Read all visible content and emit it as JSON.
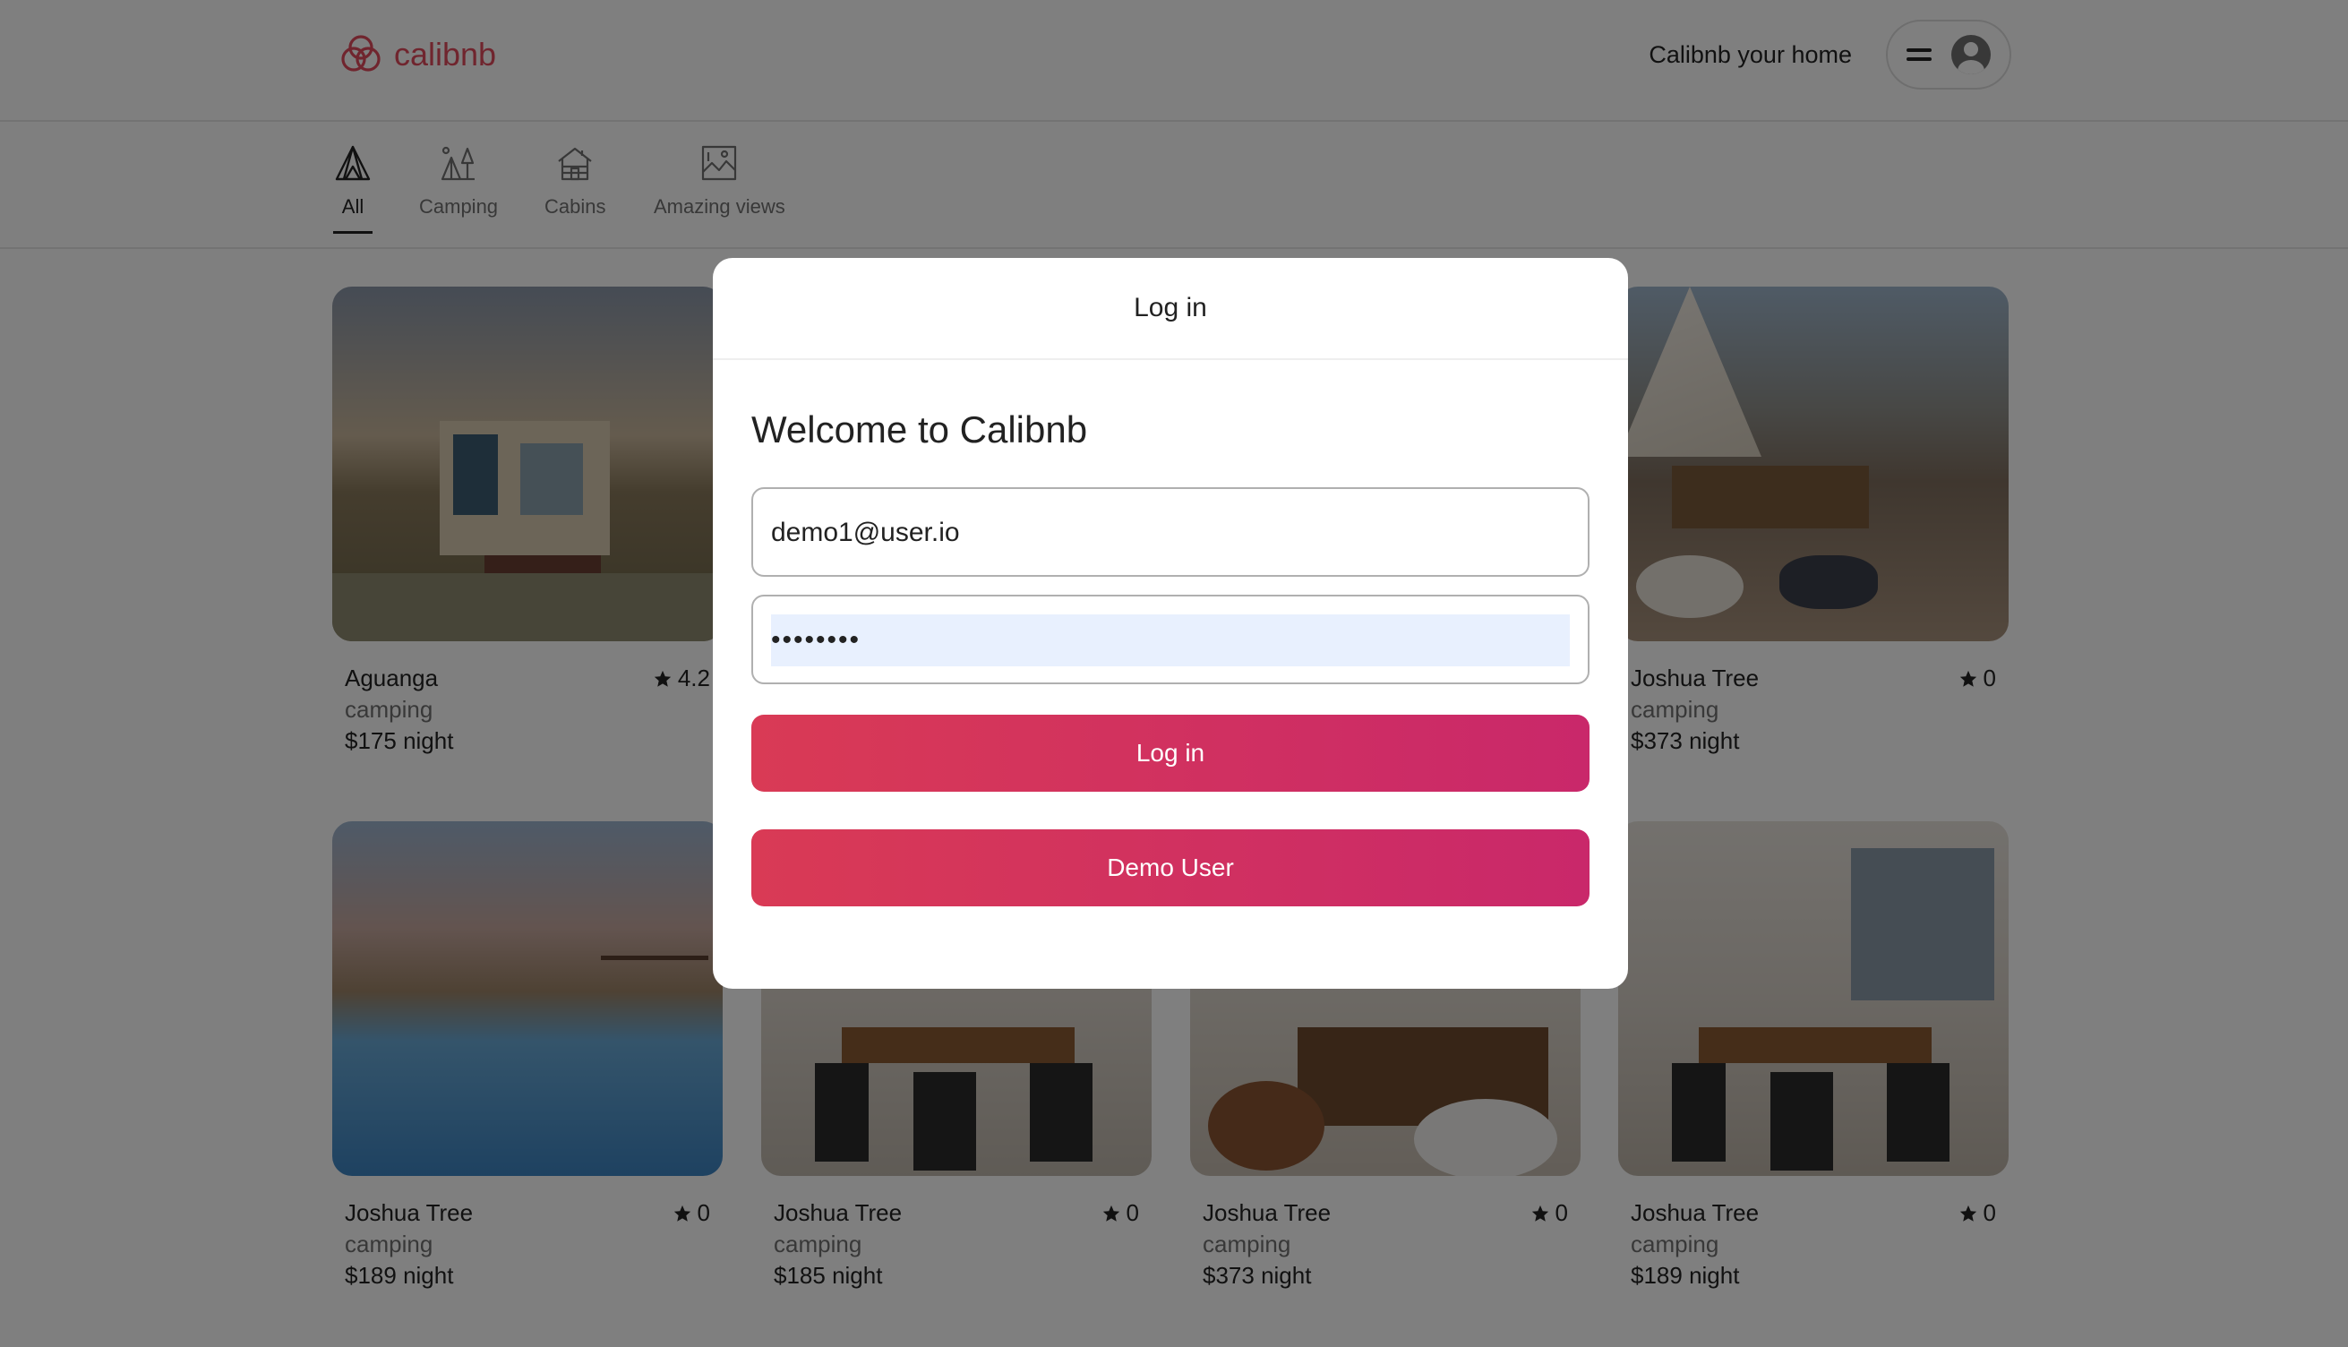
{
  "brand": {
    "name": "calibnb",
    "color": "#e14a5d"
  },
  "header": {
    "host_link": "Calibnb your home"
  },
  "categories": [
    {
      "label": "All",
      "icon": "tent-icon",
      "active": true
    },
    {
      "label": "Camping",
      "icon": "camping-icon",
      "active": false
    },
    {
      "label": "Cabins",
      "icon": "cabin-icon",
      "active": false
    },
    {
      "label": "Amazing views",
      "icon": "views-icon",
      "active": false
    }
  ],
  "listings": [
    {
      "title": "Aguanga",
      "type": "camping",
      "price": "$175 night",
      "rating": "4.2"
    },
    {
      "title": "",
      "type": "",
      "price": "",
      "rating": ""
    },
    {
      "title": "",
      "type": "",
      "price": "",
      "rating": ""
    },
    {
      "title": "Joshua Tree",
      "type": "camping",
      "price": "$373 night",
      "rating": "0"
    },
    {
      "title": "Joshua Tree",
      "type": "camping",
      "price": "$189 night",
      "rating": "0"
    },
    {
      "title": "Joshua Tree",
      "type": "camping",
      "price": "$185 night",
      "rating": "0"
    },
    {
      "title": "Joshua Tree",
      "type": "camping",
      "price": "$373 night",
      "rating": "0"
    },
    {
      "title": "Joshua Tree",
      "type": "camping",
      "price": "$189 night",
      "rating": "0"
    }
  ],
  "modal": {
    "title": "Log in",
    "welcome": "Welcome to Calibnb",
    "email_value": "demo1@user.io",
    "password_value": "password",
    "login_button": "Log in",
    "demo_button": "Demo User",
    "button_color": "#d93a55"
  }
}
